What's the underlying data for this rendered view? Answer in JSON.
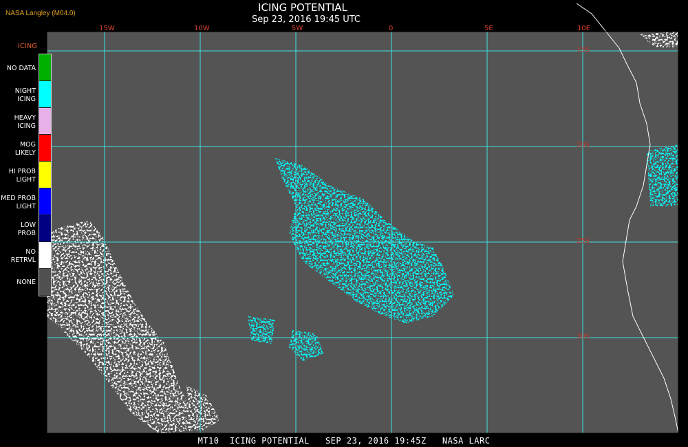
{
  "header": {
    "producer": "NASA Langley (M04.0)",
    "title": "ICING POTENTIAL",
    "subtitle": "Sep 23, 2016 19:45 UTC"
  },
  "legend": {
    "heading": "ICING",
    "items": [
      {
        "label": "NO DATA",
        "color": "#00b000"
      },
      {
        "label": "NIGHT\nICING",
        "color": "#00ffff"
      },
      {
        "label": "HEAVY\nICING",
        "color": "#e8b0e8"
      },
      {
        "label": "MOG\nLIKELY",
        "color": "#ff0000"
      },
      {
        "label": "HI PROB\nLIGHT",
        "color": "#ffff00"
      },
      {
        "label": "MED PROB\nLIGHT",
        "color": "#0000ff"
      },
      {
        "label": "LOW\nPROB",
        "color": "#000080"
      },
      {
        "label": "NO\nRETRVL",
        "color": "#ffffff"
      },
      {
        "label": "NONE",
        "color": "#505050"
      }
    ]
  },
  "map": {
    "background_color": "#545454",
    "grid_color": "#40e0e0",
    "coastline_color": "#ffffff",
    "longitude_labels": [
      "15W",
      "10W",
      "5W",
      "0",
      "5E",
      "10E"
    ],
    "latitude_labels": [
      "15S",
      "20S",
      "25S",
      "30S"
    ]
  },
  "footer": {
    "text": "MT10  ICING POTENTIAL   SEP 23, 2016 19:45Z   NASA LARC"
  }
}
